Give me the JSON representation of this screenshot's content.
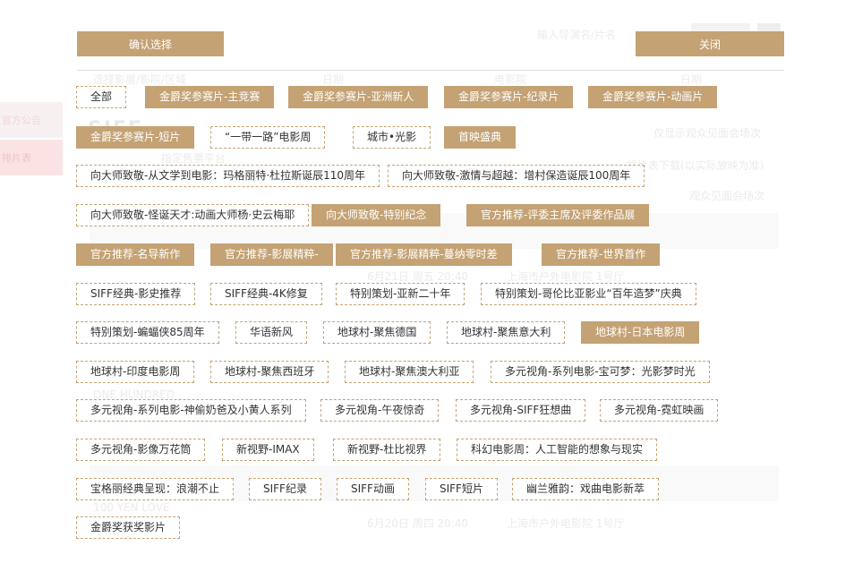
{
  "modal": {
    "confirm_label": "确认选择",
    "close_label": "关闭"
  },
  "background": {
    "side_tabs": [
      "官方公告",
      "排片表"
    ],
    "search_placeholder": "输入导演名/片名",
    "filters": [
      "选择影展/影院/区域",
      "日期",
      "电影院",
      "日期"
    ],
    "logo_text": "SIFF",
    "platform_label": "指定售票平台",
    "options": [
      "仅显示观众见面会场次",
      "排片表下载(以实际放映为准)",
      "观众见面会场次"
    ],
    "listing_rows": [
      {
        "time": "6月21日 周五 20:40",
        "cinema": "上海市户外电影院 1号厅"
      },
      {
        "time": "6月20日 周四 20:40",
        "cinema": "上海市户外电影院 1号厅"
      }
    ],
    "film_titles": [
      "ONE HUNDRED",
      "100 YEN LOVE"
    ]
  },
  "colors": {
    "accent": "#c4a274",
    "selected_text": "#ffffff",
    "tag_text": "#333333"
  },
  "tag_rows": [
    [
      {
        "label": "全部",
        "selected": false
      },
      {
        "label": "金爵奖参赛片-主竞赛",
        "selected": true
      },
      {
        "label": "金爵奖参赛片-亚洲新人",
        "selected": true
      },
      {
        "label": "金爵奖参赛片-纪录片",
        "selected": true
      },
      {
        "label": "金爵奖参赛片-动画片",
        "selected": true
      }
    ],
    [
      {
        "label": "金爵奖参赛片-短片",
        "selected": true
      },
      {
        "label": "“一带一路”电影周",
        "selected": false
      },
      {
        "label": "城市•光影",
        "selected": false
      },
      {
        "label": "首映盛典",
        "selected": true
      }
    ],
    [
      {
        "label": "向大师致敬-从文学到电影：玛格丽特·杜拉斯诞辰110周年",
        "selected": false
      },
      {
        "label": "向大师致敬-激情与超越：增村保造诞辰100周年",
        "selected": false
      }
    ],
    [
      {
        "label": "向大师致敬-怪诞天才:动画大师杨·史云梅耶",
        "selected": false
      },
      {
        "label": "向大师致敬-特别纪念",
        "selected": true
      },
      {
        "label": "官方推荐-评委主席及评委作品展",
        "selected": true
      }
    ],
    [
      {
        "label": "官方推荐-名导新作",
        "selected": true
      },
      {
        "label": "官方推荐-影展精粹-",
        "selected": true
      },
      {
        "label": "官方推荐-影展精粹-蔓纳零时差",
        "selected": true
      },
      {
        "label": "官方推荐-世界首作",
        "selected": true
      }
    ],
    [
      {
        "label": "SIFF经典-影史推荐",
        "selected": false
      },
      {
        "label": "SIFF经典-4K修复",
        "selected": false
      },
      {
        "label": "特别策划-亚新二十年",
        "selected": false
      },
      {
        "label": "特别策划-哥伦比亚影业“百年造梦”庆典",
        "selected": false
      }
    ],
    [
      {
        "label": "特别策划-蝙蝠侠85周年",
        "selected": false
      },
      {
        "label": "华语新风",
        "selected": false
      },
      {
        "label": "地球村-聚焦德国",
        "selected": false
      },
      {
        "label": "地球村-聚焦意大利",
        "selected": false
      },
      {
        "label": "地球村-日本电影周",
        "selected": true
      }
    ],
    [
      {
        "label": "地球村-印度电影周",
        "selected": false
      },
      {
        "label": "地球村-聚焦西班牙",
        "selected": false
      },
      {
        "label": "地球村-聚焦澳大利亚",
        "selected": false
      },
      {
        "label": "多元视角-系列电影-宝可梦：光影梦时光",
        "selected": false
      }
    ],
    [
      {
        "label": "多元视角-系列电影-神偷奶爸及小黄人系列",
        "selected": false
      },
      {
        "label": "多元视角-午夜惊奇",
        "selected": false
      },
      {
        "label": "多元视角-SIFF狂想曲",
        "selected": false
      },
      {
        "label": "多元视角-霓虹映画",
        "selected": false
      }
    ],
    [
      {
        "label": "多元视角-影像万花筒",
        "selected": false
      },
      {
        "label": "新视野-IMAX",
        "selected": false
      },
      {
        "label": "新视野-杜比视界",
        "selected": false
      },
      {
        "label": "科幻电影周：人工智能的想象与现实",
        "selected": false
      }
    ],
    [
      {
        "label": "宝格丽经典呈现：浪潮不止",
        "selected": false
      },
      {
        "label": "SIFF纪录",
        "selected": false
      },
      {
        "label": "SIFF动画",
        "selected": false
      },
      {
        "label": "SIFF短片",
        "selected": false
      },
      {
        "label": "幽兰雅韵：戏曲电影新萃",
        "selected": false
      }
    ],
    [
      {
        "label": "金爵奖获奖影片",
        "selected": false
      }
    ]
  ]
}
